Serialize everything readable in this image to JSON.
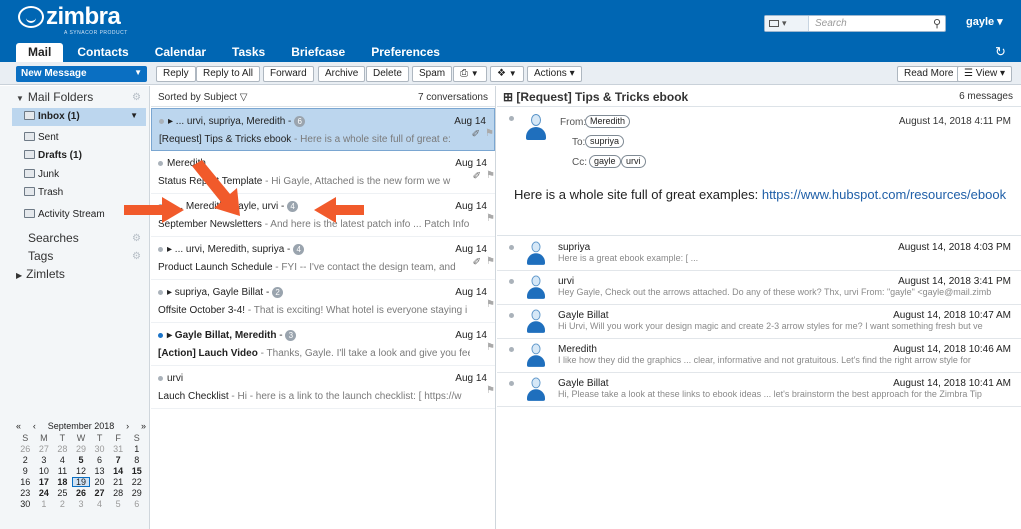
{
  "app": {
    "logo": "zimbra",
    "logo_sub": "A SYNACOR PRODUCT"
  },
  "search": {
    "type_label": "▾",
    "placeholder": "Search"
  },
  "user": {
    "name": "gayle ▾"
  },
  "tabs": [
    {
      "label": "Mail",
      "active": true
    },
    {
      "label": "Contacts"
    },
    {
      "label": "Calendar"
    },
    {
      "label": "Tasks"
    },
    {
      "label": "Briefcase"
    },
    {
      "label": "Preferences"
    }
  ],
  "toolbar": {
    "new_message": "New Message",
    "reply": "Reply",
    "reply_all": "Reply to All",
    "forward": "Forward",
    "archive": "Archive",
    "delete": "Delete",
    "spam": "Spam",
    "actions": "Actions ▾",
    "read_more": "Read More",
    "view": "View ▾"
  },
  "sidebar": {
    "mail_folders": "Mail Folders",
    "folders": [
      {
        "label": "Inbox (1)",
        "selected": true
      },
      {
        "label": "Sent"
      },
      {
        "label": "Drafts (1)",
        "bold": true
      },
      {
        "label": "Junk"
      },
      {
        "label": "Trash"
      },
      {
        "label": "Activity Stream"
      }
    ],
    "searches": "Searches",
    "tags": "Tags",
    "zimlets": "Zimlets"
  },
  "calendar": {
    "month": "September 2018",
    "dow": [
      "S",
      "M",
      "T",
      "W",
      "T",
      "F",
      "S"
    ],
    "weeks": [
      [
        "26",
        "27",
        "28",
        "29",
        "30",
        "31",
        "1"
      ],
      [
        "2",
        "3",
        "4",
        "5",
        "6",
        "7",
        "8"
      ],
      [
        "9",
        "10",
        "11",
        "12",
        "13",
        "14",
        "15"
      ],
      [
        "16",
        "17",
        "18",
        "19",
        "20",
        "21",
        "22"
      ],
      [
        "23",
        "24",
        "25",
        "26",
        "27",
        "28",
        "29"
      ],
      [
        "30",
        "1",
        "2",
        "3",
        "4",
        "5",
        "6"
      ]
    ],
    "today": "19"
  },
  "list": {
    "sort_label": "Sorted by Subject",
    "count": "7 conversations",
    "conversations": [
      {
        "from": "▸ ... urvi, supriya, Meredith",
        "badge": "6",
        "date": "Aug 14",
        "subject": "[Request] Tips & Tricks ebook",
        "fragment": " - Here is a whole site full of great e:",
        "selected": true,
        "unread": false,
        "clip": true
      },
      {
        "from": "Meredith",
        "badge": "",
        "date": "Aug 14",
        "subject": "Status Report Template",
        "fragment": " - Hi Gayle, Attached is the new form we w",
        "selected": false,
        "unread": false,
        "clip": true
      },
      {
        "from": "▸ ... Meredith, Gayle, urvi",
        "badge": "4",
        "date": "Aug 14",
        "subject": "September Newsletters",
        "fragment": " - And here is the latest patch info ... Patch Info",
        "selected": false,
        "unread": false,
        "clip": false
      },
      {
        "from": "▸ ... urvi, Meredith, supriya",
        "badge": "4",
        "date": "Aug 14",
        "subject": "Product Launch Schedule",
        "fragment": " - FYI -- I've contact the design team, and",
        "selected": false,
        "unread": false,
        "clip": true
      },
      {
        "from": "▸ supriya, Gayle Billat",
        "badge": "2",
        "date": "Aug 14",
        "subject": "Offsite October 3-4!",
        "fragment": " - That is exciting! What hotel is everyone staying i",
        "selected": false,
        "unread": false,
        "clip": false
      },
      {
        "from": "▸ Gayle Billat, Meredith",
        "badge": "3",
        "date": "Aug 14",
        "subject": "[Action] Lauch Video",
        "fragment": " - Thanks, Gayle. I'll take a look and give you fee",
        "selected": false,
        "unread": true,
        "clip": false
      },
      {
        "from": "urvi",
        "badge": "",
        "date": "Aug 14",
        "subject": "Lauch Checklist",
        "fragment": " - Hi - here is a link to the launch checklist: [ https://w",
        "selected": false,
        "unread": false,
        "clip": false
      }
    ]
  },
  "reading": {
    "subject": "⊞ [Request] Tips & Tricks ebook",
    "count": "6 messages",
    "from_label": "From:",
    "to_label": "To:",
    "cc_label": "Cc:",
    "from": "Meredith",
    "to": "supriya",
    "cc": [
      "gayle",
      "urvi"
    ],
    "date": "August 14, 2018 4:11 PM",
    "body_text": "Here is a whole site full of great examples: ",
    "body_link": "https://www.hubspot.com/resources/ebook",
    "thread": [
      {
        "sender": "supriya",
        "time": "August 14, 2018 4:03 PM",
        "snippet": "Here is a great ebook example: [ ..."
      },
      {
        "sender": "urvi",
        "time": "August 14, 2018 3:41 PM",
        "snippet": "Hey Gayle, Check out the arrows attached. Do any of these work? Thx, urvi From: \"gayle\" <gayle@mail.zimb"
      },
      {
        "sender": "Gayle Billat",
        "time": "August 14, 2018 10:47 AM",
        "snippet": "Hi Urvi, Will you work your design magic and create 2-3 arrow styles for me? I want something fresh but ve"
      },
      {
        "sender": "Meredith",
        "time": "August 14, 2018 10:46 AM",
        "snippet": "I like how they did the graphics ... clear, informative and not gratuitous. Let's find the right arrow style for"
      },
      {
        "sender": "Gayle Billat",
        "time": "August 14, 2018 10:41 AM",
        "snippet": "Hi, Please take a look at these links to ebook ideas ... let's brainstorm the best approach for the Zimbra Tip"
      }
    ]
  },
  "colors": {
    "brand": "#0066b3",
    "selection": "#bcd6ee",
    "arrow": "#f15a2b"
  }
}
